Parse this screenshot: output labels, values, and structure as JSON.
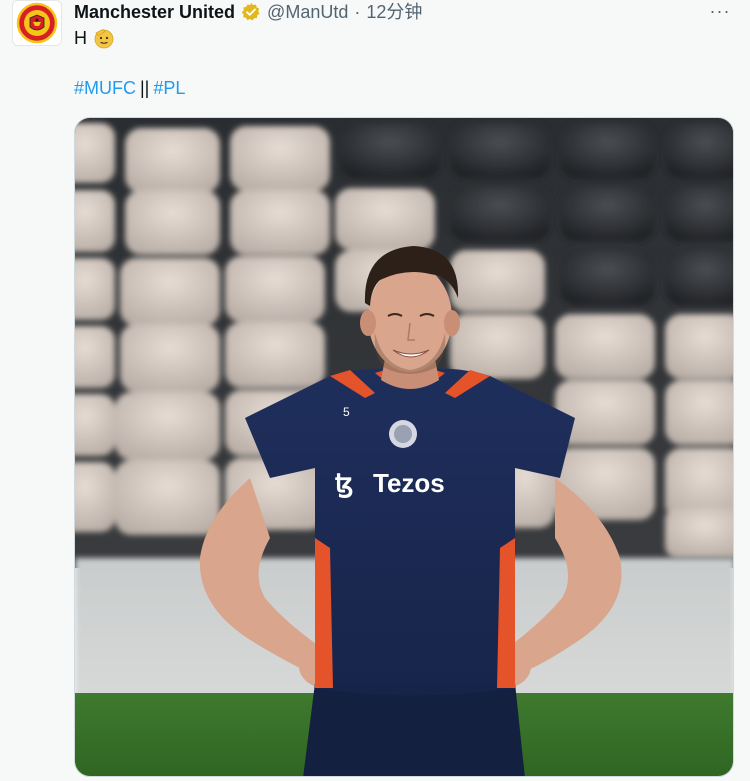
{
  "account": {
    "display_name": "Manchester United",
    "handle": "@ManUtd",
    "separator": "·",
    "timestamp": "12分钟",
    "verified_icon": "gold-verified-badge-icon",
    "avatar_icon": "manchester-united-crest-icon",
    "avatar_crest_text": "MANCHESTER UNITED"
  },
  "tweet": {
    "text": "H",
    "emoji": "saluting-face-emoji",
    "hashtag_1": "#MUFC",
    "separator": "||",
    "hashtag_2": "#PL",
    "more_icon": "more-options-icon",
    "more_label": "···"
  },
  "media": {
    "description_icon": "photo",
    "shirt_sponsor": "Tezos",
    "shirt_number": "5"
  },
  "colors": {
    "link": "#1d9bf0",
    "verified": "#e2b719",
    "muted": "#536471",
    "text": "#0f1419",
    "kit_navy": "#1b2a52",
    "kit_orange": "#e5532a"
  }
}
